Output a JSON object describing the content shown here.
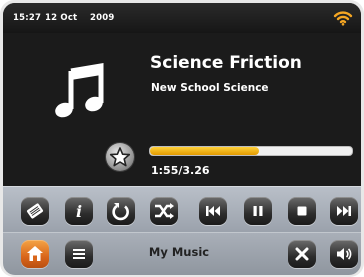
{
  "status_bar": {
    "time": "15:27",
    "date": "12 Oct",
    "year": "2009",
    "wifi_icon": "wifi-icon"
  },
  "now_playing": {
    "title": "Science Friction",
    "artist": "New School Science",
    "art_icon": "music-note-icon",
    "favorite_icon": "star-icon",
    "time_display": "1:55/3.26",
    "progress_fraction": 0.54
  },
  "controls": {
    "buttons": [
      {
        "name": "eject-disc-button",
        "icon": "disc-icon"
      },
      {
        "name": "info-button",
        "icon": "info-icon"
      },
      {
        "name": "repeat-button",
        "icon": "repeat-icon"
      },
      {
        "name": "shuffle-button",
        "icon": "shuffle-icon"
      },
      {
        "name": "previous-track-button",
        "icon": "previous-icon"
      },
      {
        "name": "pause-button",
        "icon": "pause-icon"
      },
      {
        "name": "stop-button",
        "icon": "stop-icon"
      },
      {
        "name": "next-track-button",
        "icon": "next-icon"
      }
    ]
  },
  "bottom_bar": {
    "home_icon": "home-icon",
    "menu_icon": "menu-icon",
    "source_label": "My Music",
    "close_icon": "close-icon",
    "volume_icon": "volume-icon"
  },
  "colors": {
    "accent_orange": "#e27a1f",
    "progress_fill": "#f5b400",
    "screen_background": "#1b1b1b"
  }
}
